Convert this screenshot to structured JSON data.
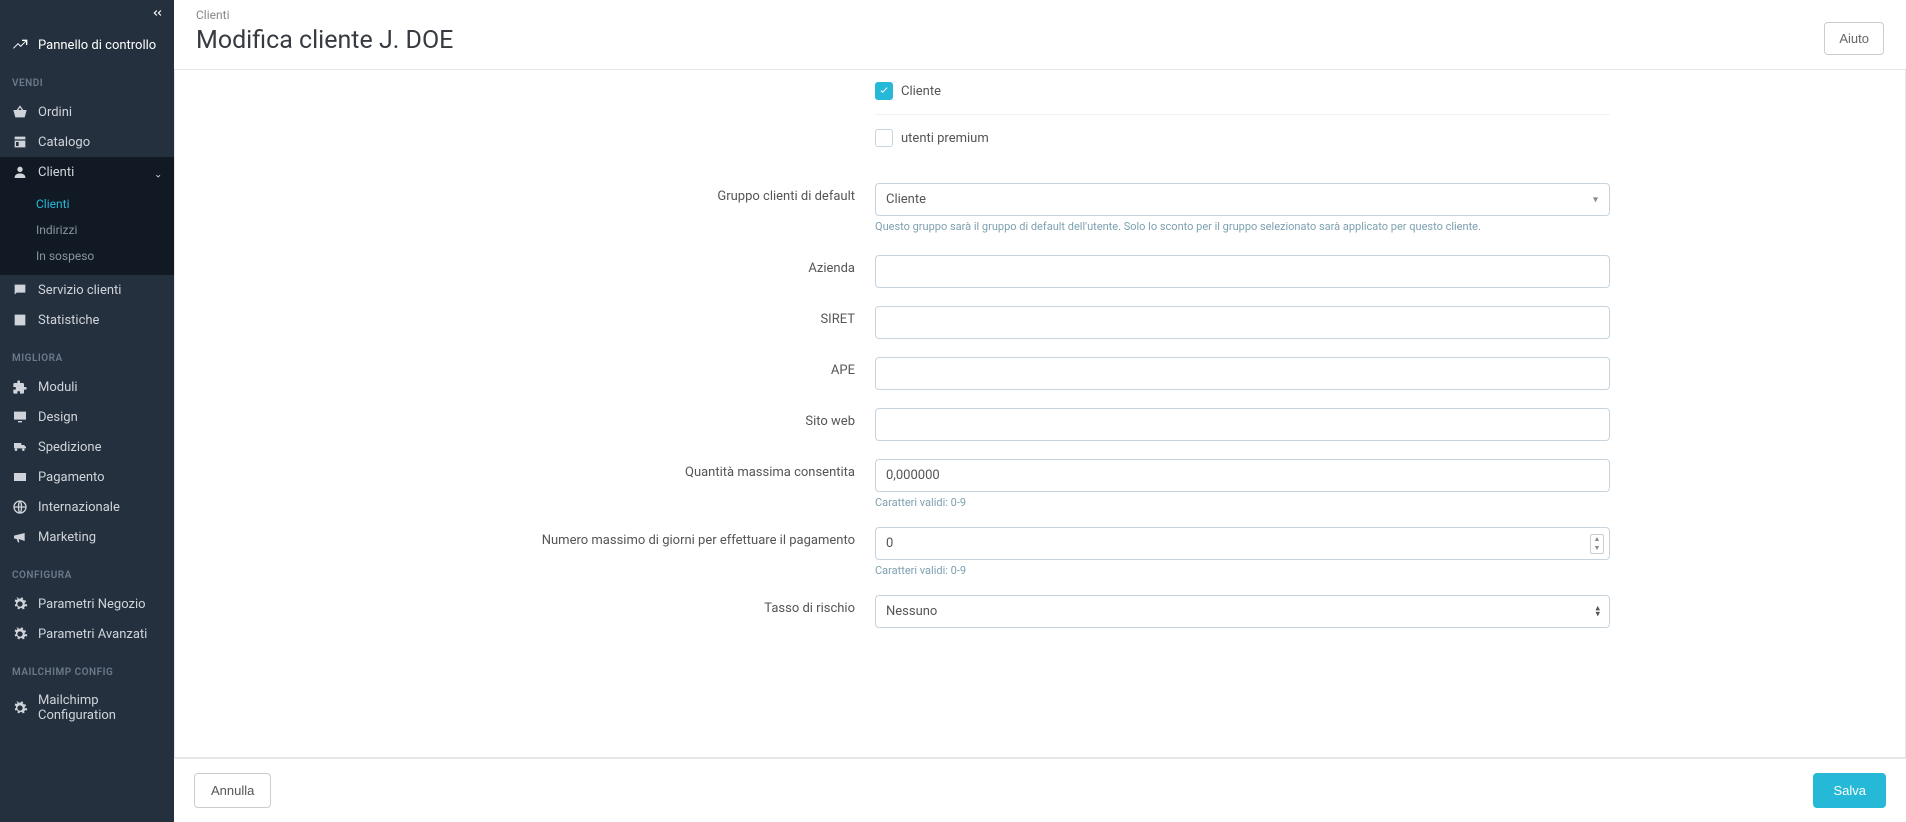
{
  "sidebar": {
    "dashboard": "Pannello di controllo",
    "sections": {
      "vendi": "VENDI",
      "migliora": "MIGLIORA",
      "configura": "CONFIGURA",
      "mailchimp": "MAILCHIMP CONFIG"
    },
    "items": {
      "ordini": "Ordini",
      "catalogo": "Catalogo",
      "clienti": "Clienti",
      "servizio": "Servizio clienti",
      "statistiche": "Statistiche",
      "moduli": "Moduli",
      "design": "Design",
      "spedizione": "Spedizione",
      "pagamento": "Pagamento",
      "internazionale": "Internazionale",
      "marketing": "Marketing",
      "parametri_negozio": "Parametri Negozio",
      "parametri_avanzati": "Parametri Avanzati",
      "mailchimp_config": "Mailchimp Configuration"
    },
    "sub_clienti": {
      "clienti": "Clienti",
      "indirizzi": "Indirizzi",
      "sospeso": "In sospeso"
    }
  },
  "header": {
    "breadcrumb": "Clienti",
    "title": "Modifica cliente J. DOE",
    "help": "Aiuto"
  },
  "form": {
    "cb_cliente": "Cliente",
    "cb_premium": "utenti premium",
    "gruppo_default_label": "Gruppo clienti di default",
    "gruppo_default_value": "Cliente",
    "gruppo_default_hint": "Questo gruppo sarà il gruppo di default dell'utente. Solo lo sconto per il gruppo selezionato sarà applicato per questo cliente.",
    "azienda_label": "Azienda",
    "azienda_value": "",
    "siret_label": "SIRET",
    "siret_value": "",
    "ape_label": "APE",
    "ape_value": "",
    "sito_label": "Sito web",
    "sito_value": "",
    "qmax_label": "Quantità massima consentita",
    "qmax_value": "0,000000",
    "qmax_hint": "Caratteri validi: 0-9",
    "giorni_label": "Numero massimo di giorni per effettuare il pagamento",
    "giorni_value": "0",
    "giorni_hint": "Caratteri validi: 0-9",
    "rischio_label": "Tasso di rischio",
    "rischio_value": "Nessuno"
  },
  "footer": {
    "cancel": "Annulla",
    "save": "Salva"
  }
}
